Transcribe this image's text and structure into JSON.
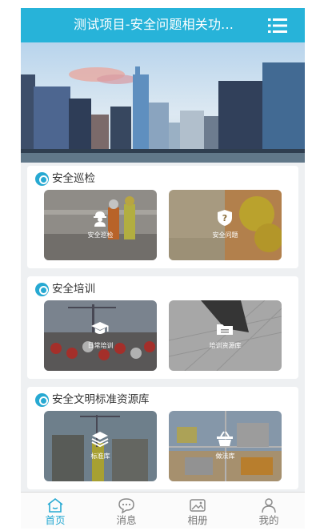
{
  "header": {
    "title": "测试项目-安全问题相关功...",
    "menu_icon": "menu-icon"
  },
  "hero": {
    "image": "city-skyline-banner"
  },
  "sections": [
    {
      "title": "安全巡检",
      "tiles": [
        {
          "label": "安全巡检",
          "icon": "worker-icon"
        },
        {
          "label": "安全问题",
          "icon": "question-shield-icon"
        }
      ]
    },
    {
      "title": "安全培训",
      "tiles": [
        {
          "label": "日常培训",
          "icon": "graduation-cap-icon"
        },
        {
          "label": "培训资源库",
          "icon": "folder-icon"
        }
      ]
    },
    {
      "title": "安全文明标准资源库",
      "tiles": [
        {
          "label": "标准库",
          "icon": "layers-icon"
        },
        {
          "label": "做法库",
          "icon": "basket-icon"
        }
      ]
    }
  ],
  "tabbar": {
    "items": [
      {
        "label": "首页",
        "icon": "home-icon",
        "active": true
      },
      {
        "label": "消息",
        "icon": "message-icon",
        "active": false
      },
      {
        "label": "相册",
        "icon": "album-icon",
        "active": false
      },
      {
        "label": "我的",
        "icon": "user-icon",
        "active": false
      }
    ]
  },
  "colors": {
    "accent": "#27b3d9",
    "active_tab": "#27a9d2",
    "background": "#eef0f2"
  }
}
